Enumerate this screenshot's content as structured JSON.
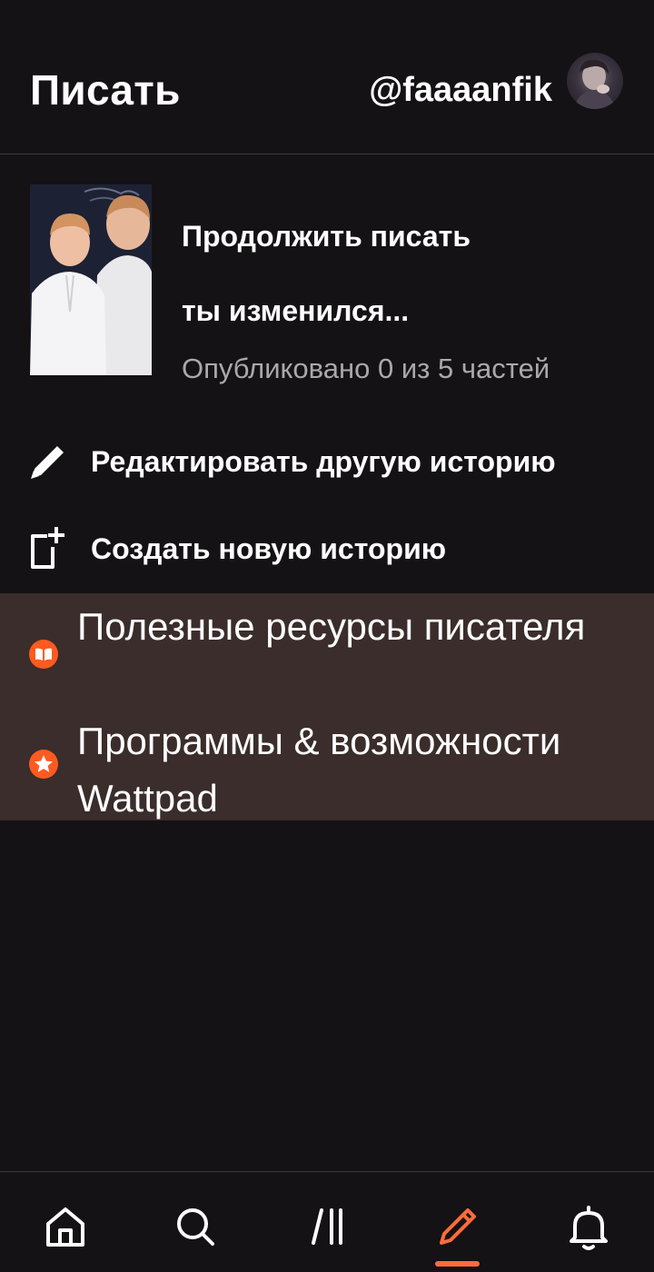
{
  "header": {
    "title": "Писать",
    "username": "@faaaanfik"
  },
  "continue_card": {
    "label": "Продолжить писать",
    "story_title": "ты изменился...",
    "status": "Опубликовано 0 из 5 частей"
  },
  "actions": {
    "edit_story": "Редактировать другую историю",
    "create_story": "Создать новую историю"
  },
  "resources": [
    {
      "label": "Полезные ресурсы писателя",
      "icon": "book-icon"
    },
    {
      "label": "Программы & возможности Wattpad",
      "icon": "star-icon"
    }
  ],
  "nav": {
    "items": [
      "home-icon",
      "search-icon",
      "library-icon",
      "write-icon",
      "notifications-icon"
    ],
    "active": "write-icon"
  },
  "colors": {
    "background": "#141214",
    "accent": "#ff6c3a",
    "resources_bg": "#3a2d2b",
    "muted_text": "#a9a9ab"
  }
}
